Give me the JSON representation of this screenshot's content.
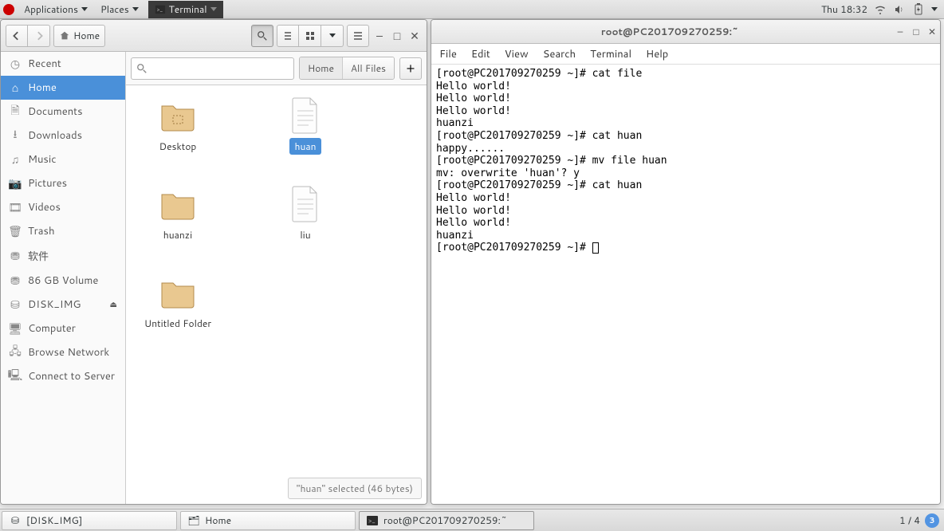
{
  "panel": {
    "applications": "Applications",
    "places": "Places",
    "terminal": "Terminal",
    "clock": "Thu 18:32"
  },
  "files": {
    "home_btn": "Home",
    "search_placeholder": "",
    "pathbar": {
      "home": "Home",
      "all": "All Files"
    },
    "sidebar": {
      "recent": "Recent",
      "home": "Home",
      "documents": "Documents",
      "downloads": "Downloads",
      "music": "Music",
      "pictures": "Pictures",
      "videos": "Videos",
      "trash": "Trash",
      "software": "软件",
      "volume": "86 GB Volume",
      "disk_img": "DISK_IMG",
      "computer": "Computer",
      "browse": "Browse Network",
      "connect": "Connect to Server"
    },
    "items": {
      "desktop": "Desktop",
      "huan": "huan",
      "huanzi": "huanzi",
      "liu": "liu",
      "untitled": "Untitled Folder"
    },
    "status": "\"huan\" selected (46 bytes)"
  },
  "terminal": {
    "title": "root@PC201709270259:~",
    "menu": {
      "file": "File",
      "edit": "Edit",
      "view": "View",
      "search": "Search",
      "terminal": "Terminal",
      "help": "Help"
    },
    "lines": [
      "[root@PC201709270259 ~]# cat file",
      "Hello world!",
      "Hello world!",
      "Hello world!",
      "huanzi",
      "[root@PC201709270259 ~]# cat huan",
      "happy......",
      "[root@PC201709270259 ~]# mv file huan",
      "mv: overwrite 'huan'? y",
      "[root@PC201709270259 ~]# cat huan",
      "Hello world!",
      "Hello world!",
      "Hello world!",
      "huanzi",
      "[root@PC201709270259 ~]# "
    ]
  },
  "taskbar": {
    "disk": "[DISK_IMG]",
    "home": "Home",
    "term": "root@PC201709270259:~",
    "workspace": "1 / 4",
    "badge": "3"
  }
}
